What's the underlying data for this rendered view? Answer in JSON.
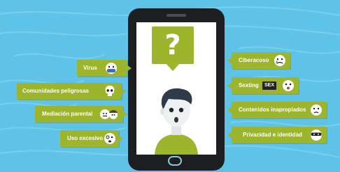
{
  "question_mark": "?",
  "tags_left": [
    {
      "label": "Virus",
      "icon": "sick-face-icon"
    },
    {
      "label": "Comunidades peligrosas",
      "icon": "skull-icon"
    },
    {
      "label": "Mediación parental",
      "icon": "parent-child-faces-icon"
    },
    {
      "label": "Uso excesivo",
      "icon": "dizzy-face-icon"
    }
  ],
  "tags_right": [
    {
      "label": "Ciberacoso",
      "icon": "crying-face-icon"
    },
    {
      "label": "Sexting",
      "badge": "SEX",
      "icon": "shocked-face-icon"
    },
    {
      "label": "Contenidos inapropiados",
      "icon": "disappointed-face-icon"
    },
    {
      "label": "Privacidad e identidad",
      "icon": "masked-face-icon"
    }
  ],
  "colors": {
    "background": "#5ec3e6",
    "tag": "#9db42d",
    "phone": "#1d1e22"
  }
}
